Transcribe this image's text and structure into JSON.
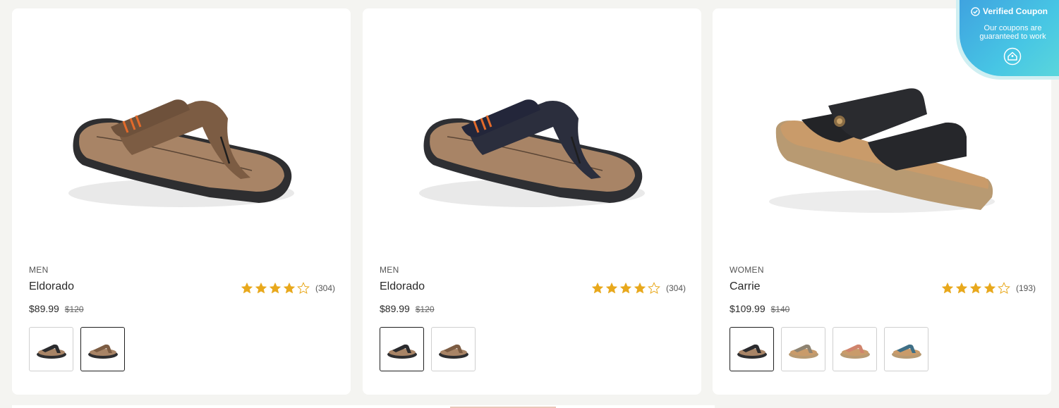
{
  "coupon": {
    "title": "Verified Coupon",
    "subtitle_line1": "Our coupons are",
    "subtitle_line2": "guaranteed to work"
  },
  "colors": {
    "star": "#e8a81c",
    "coupon_start": "#3fa3e0",
    "coupon_end": "#5ad6dc"
  },
  "products": [
    {
      "category": "MEN",
      "name": "Eldorado",
      "rating": 4,
      "review_count": "(304)",
      "price": "$89.99",
      "compare_price": "$120",
      "swatches": [
        "black",
        "brown"
      ],
      "selected_swatch": 1
    },
    {
      "category": "MEN",
      "name": "Eldorado",
      "rating": 4,
      "review_count": "(304)",
      "price": "$89.99",
      "compare_price": "$120",
      "swatches": [
        "black",
        "brown"
      ],
      "selected_swatch": 0
    },
    {
      "category": "WOMEN",
      "name": "Carrie",
      "rating": 4,
      "review_count": "(193)",
      "price": "$109.99",
      "compare_price": "$140",
      "swatches": [
        "black",
        "taupe",
        "coral",
        "teal"
      ],
      "selected_swatch": 0
    }
  ]
}
